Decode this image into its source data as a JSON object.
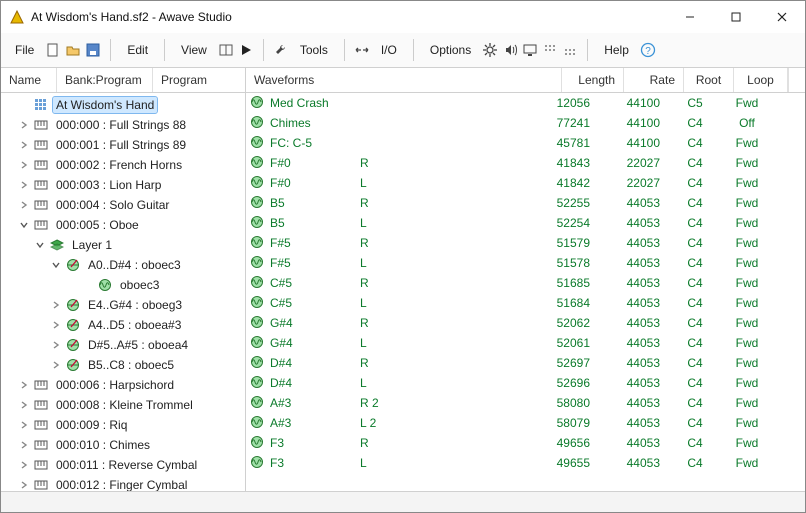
{
  "window": {
    "title": "At Wisdom's Hand.sf2 - Awave Studio"
  },
  "menubar": {
    "file": "File",
    "edit": "Edit",
    "view": "View",
    "tools": "Tools",
    "io": "I/O",
    "options": "Options",
    "help": "Help"
  },
  "left_header": {
    "col_name": "Name",
    "col_bankprog": "Bank:Program",
    "col_program": "Program"
  },
  "right_header": {
    "col_waveforms": "Waveforms",
    "col_length": "Length",
    "col_rate": "Rate",
    "col_root": "Root",
    "col_loop": "Loop"
  },
  "root_node": "At Wisdom's Hand",
  "instruments": [
    {
      "label": "000:000 : Full Strings 88",
      "exp": false
    },
    {
      "label": "000:001 : Full Strings 89",
      "exp": false
    },
    {
      "label": "000:002 : French Horns",
      "exp": false
    },
    {
      "label": "000:003 : Lion Harp",
      "exp": false
    },
    {
      "label": "000:004 : Solo Guitar",
      "exp": false
    },
    {
      "label": "000:005 : Oboe",
      "exp": true,
      "layers": [
        {
          "label": "Layer 1",
          "exp": true,
          "regions": [
            {
              "label": "A0..D#4 : oboec3",
              "exp": true,
              "samples": [
                "oboec3"
              ]
            },
            {
              "label": "E4..G#4 : oboeg3",
              "exp": false
            },
            {
              "label": "A4..D5 : oboea#3",
              "exp": false
            },
            {
              "label": "D#5..A#5 : oboea4",
              "exp": false
            },
            {
              "label": "B5..C8 : oboec5",
              "exp": false
            }
          ]
        }
      ]
    },
    {
      "label": "000:006 : Harpsichord",
      "exp": false
    },
    {
      "label": "000:008 : Kleine Trommel",
      "exp": false
    },
    {
      "label": "000:009 : Riq",
      "exp": false
    },
    {
      "label": "000:010 : Chimes",
      "exp": false
    },
    {
      "label": "000:011 : Reverse Cymbal",
      "exp": false
    },
    {
      "label": "000:012 : Finger Cymbal",
      "exp": false
    }
  ],
  "waveforms": [
    {
      "name": "Med Crash",
      "ch": "",
      "len": 12056,
      "rate": 44100,
      "root": "C5",
      "loop": "Fwd"
    },
    {
      "name": "Chimes",
      "ch": "",
      "len": 77241,
      "rate": 44100,
      "root": "C4",
      "loop": "Off"
    },
    {
      "name": "FC: C-5",
      "ch": "",
      "len": 45781,
      "rate": 44100,
      "root": "C4",
      "loop": "Fwd"
    },
    {
      "name": "F#0",
      "ch": "R",
      "len": 41843,
      "rate": 22027,
      "root": "C4",
      "loop": "Fwd"
    },
    {
      "name": "F#0",
      "ch": "L",
      "len": 41842,
      "rate": 22027,
      "root": "C4",
      "loop": "Fwd"
    },
    {
      "name": "B5",
      "ch": "R",
      "len": 52255,
      "rate": 44053,
      "root": "C4",
      "loop": "Fwd"
    },
    {
      "name": "B5",
      "ch": "L",
      "len": 52254,
      "rate": 44053,
      "root": "C4",
      "loop": "Fwd"
    },
    {
      "name": "F#5",
      "ch": "R",
      "len": 51579,
      "rate": 44053,
      "root": "C4",
      "loop": "Fwd"
    },
    {
      "name": "F#5",
      "ch": "L",
      "len": 51578,
      "rate": 44053,
      "root": "C4",
      "loop": "Fwd"
    },
    {
      "name": "C#5",
      "ch": "R",
      "len": 51685,
      "rate": 44053,
      "root": "C4",
      "loop": "Fwd"
    },
    {
      "name": "C#5",
      "ch": "L",
      "len": 51684,
      "rate": 44053,
      "root": "C4",
      "loop": "Fwd"
    },
    {
      "name": "G#4",
      "ch": "R",
      "len": 52062,
      "rate": 44053,
      "root": "C4",
      "loop": "Fwd"
    },
    {
      "name": "G#4",
      "ch": "L",
      "len": 52061,
      "rate": 44053,
      "root": "C4",
      "loop": "Fwd"
    },
    {
      "name": "D#4",
      "ch": "R",
      "len": 52697,
      "rate": 44053,
      "root": "C4",
      "loop": "Fwd"
    },
    {
      "name": "D#4",
      "ch": "L",
      "len": 52696,
      "rate": 44053,
      "root": "C4",
      "loop": "Fwd"
    },
    {
      "name": "A#3",
      "ch": "R 2",
      "len": 58080,
      "rate": 44053,
      "root": "C4",
      "loop": "Fwd"
    },
    {
      "name": "A#3",
      "ch": "L 2",
      "len": 58079,
      "rate": 44053,
      "root": "C4",
      "loop": "Fwd"
    },
    {
      "name": "F3",
      "ch": "R",
      "len": 49656,
      "rate": 44053,
      "root": "C4",
      "loop": "Fwd"
    },
    {
      "name": "F3",
      "ch": "L",
      "len": 49655,
      "rate": 44053,
      "root": "C4",
      "loop": "Fwd"
    }
  ]
}
